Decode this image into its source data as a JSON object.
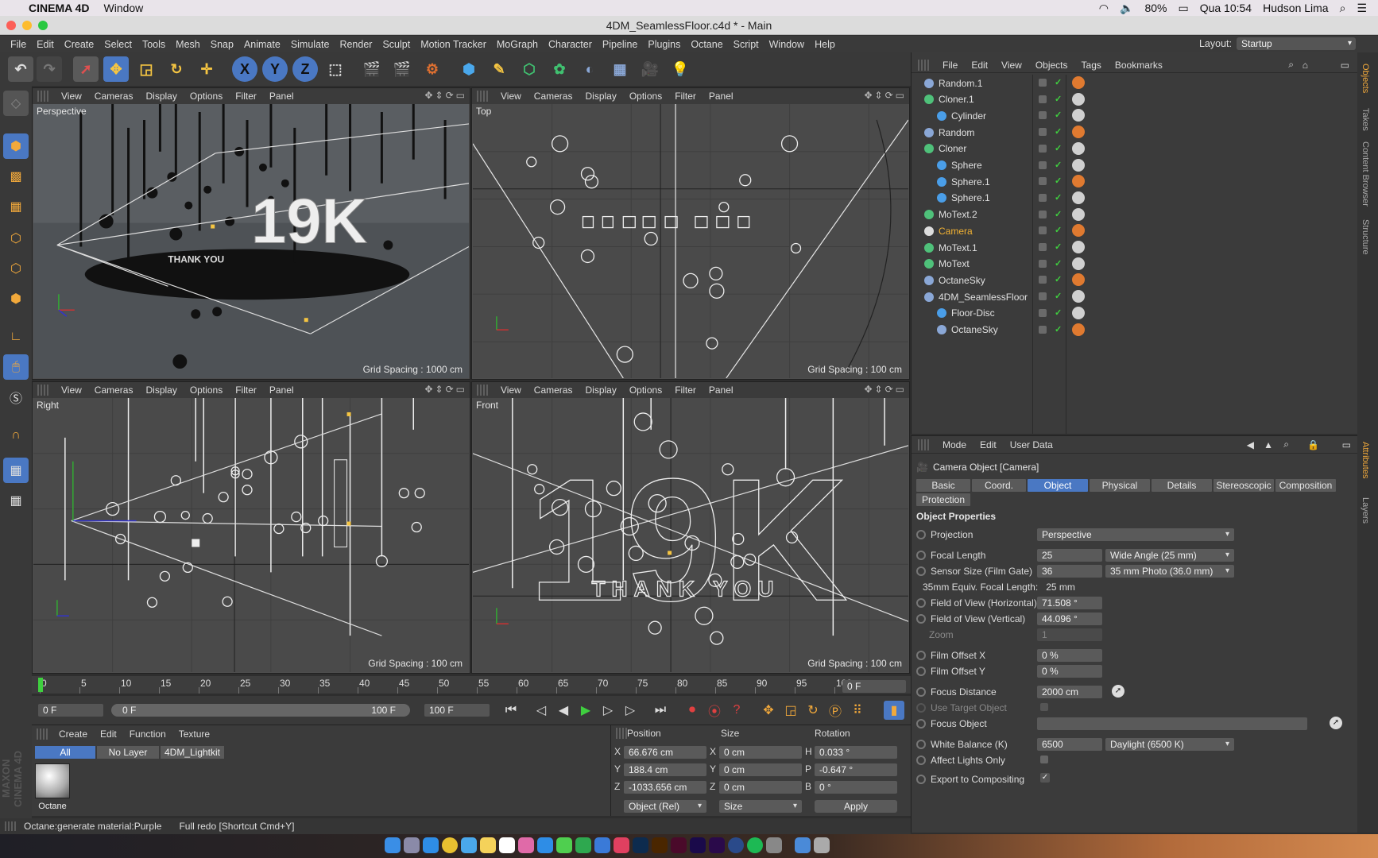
{
  "macbar": {
    "app_name": "CINEMA 4D",
    "window_menu": "Window",
    "battery": "80%",
    "clock": "Qua 10:54",
    "user": "Hudson Lima"
  },
  "window": {
    "title": "4DM_SeamlessFloor.c4d * - Main"
  },
  "menu": {
    "items": [
      "File",
      "Edit",
      "Create",
      "Select",
      "Tools",
      "Mesh",
      "Snap",
      "Animate",
      "Simulate",
      "Render",
      "Sculpt",
      "Motion Tracker",
      "MoGraph",
      "Character",
      "Pipeline",
      "Plugins",
      "Octane",
      "Script",
      "Window",
      "Help"
    ],
    "layout_label": "Layout:",
    "layout_value": "Startup"
  },
  "viewport_menu": [
    "View",
    "Cameras",
    "Display",
    "Options",
    "Filter",
    "Panel"
  ],
  "viewports": {
    "perspective": {
      "name": "Perspective",
      "grid": "Grid Spacing : 1000 cm"
    },
    "top": {
      "name": "Top",
      "grid": "Grid Spacing : 100 cm"
    },
    "right": {
      "name": "Right",
      "grid": "Grid Spacing : 100 cm"
    },
    "front": {
      "name": "Front",
      "grid": "Grid Spacing : 100 cm"
    }
  },
  "scene_text": {
    "big": "19K",
    "small": "THANK YOU"
  },
  "object_manager": {
    "menu": [
      "File",
      "Edit",
      "View",
      "Objects",
      "Tags",
      "Bookmarks"
    ],
    "objects": [
      {
        "name": "Random.1",
        "indent": 0,
        "icon": "random-icon",
        "color": "#8aa7d6",
        "active": false
      },
      {
        "name": "Cloner.1",
        "indent": 0,
        "icon": "cloner-icon",
        "color": "#4fc17a",
        "active": false
      },
      {
        "name": "Cylinder",
        "indent": 1,
        "icon": "cylinder-icon",
        "color": "#4a9ee8",
        "active": false
      },
      {
        "name": "Random",
        "indent": 0,
        "icon": "random-icon",
        "color": "#8aa7d6",
        "active": false
      },
      {
        "name": "Cloner",
        "indent": 0,
        "icon": "cloner-icon",
        "color": "#4fc17a",
        "active": false
      },
      {
        "name": "Sphere",
        "indent": 1,
        "icon": "sphere-icon",
        "color": "#4a9ee8",
        "active": false
      },
      {
        "name": "Sphere.1",
        "indent": 1,
        "icon": "sphere-icon",
        "color": "#4a9ee8",
        "active": false
      },
      {
        "name": "Sphere.1",
        "indent": 1,
        "icon": "sphere-icon",
        "color": "#4a9ee8",
        "active": false
      },
      {
        "name": "MoText.2",
        "indent": 0,
        "icon": "motext-icon",
        "color": "#4fc17a",
        "active": false
      },
      {
        "name": "Camera",
        "indent": 0,
        "icon": "camera-icon",
        "color": "#dddddd",
        "active": true
      },
      {
        "name": "MoText.1",
        "indent": 0,
        "icon": "motext-icon",
        "color": "#4fc17a",
        "active": false
      },
      {
        "name": "MoText",
        "indent": 0,
        "icon": "motext-icon",
        "color": "#4fc17a",
        "active": false
      },
      {
        "name": "OctaneSky",
        "indent": 0,
        "icon": "sky-icon",
        "color": "#8aa7d6",
        "active": false
      },
      {
        "name": "4DM_SeamlessFloor",
        "indent": 0,
        "icon": "null-icon",
        "color": "#8aa7d6",
        "active": false
      },
      {
        "name": "Floor-Disc",
        "indent": 1,
        "icon": "disc-icon",
        "color": "#4a9ee8",
        "active": false
      },
      {
        "name": "OctaneSky",
        "indent": 1,
        "icon": "sky-icon",
        "color": "#8aa7d6",
        "active": false
      }
    ]
  },
  "attributes": {
    "menu": [
      "Mode",
      "Edit",
      "User Data"
    ],
    "object_title": "Camera Object [Camera]",
    "tabs": [
      "Basic",
      "Coord.",
      "Object",
      "Physical",
      "Details",
      "Stereoscopic",
      "Composition",
      "Protection"
    ],
    "active_tab": "Object",
    "section": "Object Properties",
    "projection_label": "Projection",
    "projection_value": "Perspective",
    "focal_length_label": "Focal Length",
    "focal_length_value": "25",
    "focal_length_preset": "Wide Angle (25 mm)",
    "sensor_label": "Sensor Size (Film Gate)",
    "sensor_value": "36",
    "sensor_preset": "35 mm Photo (36.0 mm)",
    "equiv_label": "35mm Equiv. Focal Length:",
    "equiv_value": "25 mm",
    "fovh_label": "Field of View (Horizontal)",
    "fovh_value": "71.508 °",
    "fovv_label": "Field of View (Vertical)",
    "fovv_value": "44.096 °",
    "zoom_label": "Zoom",
    "zoom_value": "1",
    "filmx_label": "Film Offset X",
    "filmx_value": "0 %",
    "filmy_label": "Film Offset Y",
    "filmy_value": "0 %",
    "focus_label": "Focus Distance",
    "focus_value": "2000 cm",
    "target_label": "Use Target Object",
    "focusobj_label": "Focus Object",
    "wb_label": "White Balance (K)",
    "wb_value": "6500",
    "wb_preset": "Daylight (6500 K)",
    "affect_label": "Affect Lights Only",
    "export_label": "Export to Compositing"
  },
  "timeline": {
    "ticks": [
      "0",
      "5",
      "10",
      "15",
      "20",
      "25",
      "30",
      "35",
      "40",
      "45",
      "50",
      "55",
      "60",
      "65",
      "70",
      "75",
      "80",
      "85",
      "90",
      "95",
      "100"
    ],
    "current": "0 F",
    "start": "0 F",
    "range_start": "0 F",
    "range_end": "100 F",
    "end": "100 F"
  },
  "materials": {
    "menu": [
      "Create",
      "Edit",
      "Function",
      "Texture"
    ],
    "filters": [
      "All",
      "No Layer",
      "4DM_Lightkit"
    ],
    "material_name": "Octane"
  },
  "coords": {
    "headers": [
      "Position",
      "Size",
      "Rotation"
    ],
    "pos": {
      "x": "66.676 cm",
      "y": "188.4 cm",
      "z": "-1033.656 cm"
    },
    "size": {
      "x": "0 cm",
      "y": "0 cm",
      "z": "0 cm"
    },
    "rot": {
      "h": "0.033 °",
      "p": "-0.647 °",
      "b": "0 °"
    },
    "mode1": "Object (Rel)",
    "mode2": "Size",
    "apply": "Apply"
  },
  "status": {
    "left": "Octane:generate material:Purple",
    "right": "Full redo [Shortcut Cmd+Y]"
  },
  "brand": "MAXON CINEMA 4D",
  "right_tabs": [
    "Objects",
    "Takes",
    "Content Browser",
    "Structure",
    "Attributes",
    "Layers"
  ],
  "colors": {
    "accent": "#4a78c3",
    "camera_active": "#f2b233",
    "viewport_bg": "#4d4d4d",
    "panel_bg": "#3b3b3b"
  }
}
